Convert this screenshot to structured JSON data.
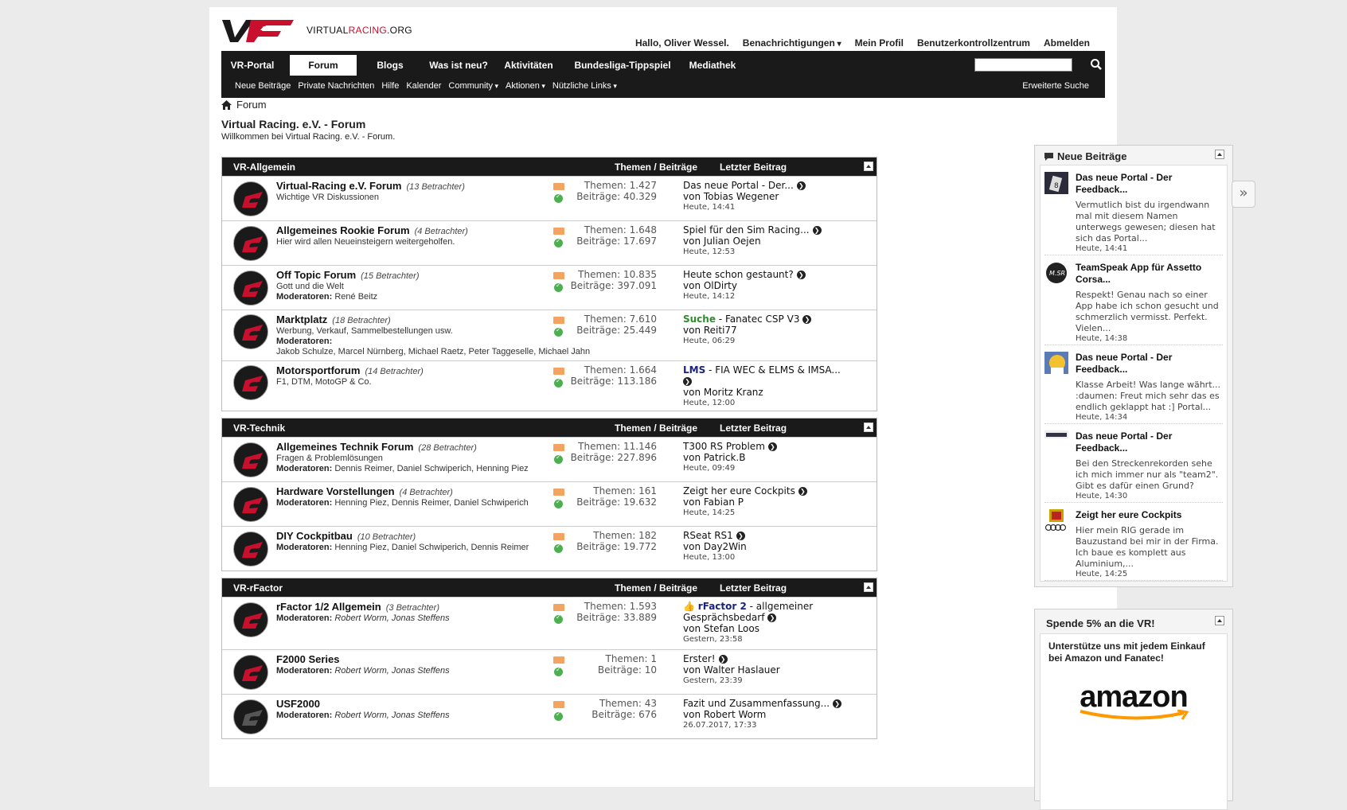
{
  "header": {
    "logo_text_pre": "VIRTUAL",
    "logo_text_red": "RACING",
    "logo_text_post": ".ORG",
    "user_links": [
      "Hallo, Oliver Wessel.",
      "Benachrichtigungen",
      "Mein Profil",
      "Benutzerkontrollzentrum",
      "Abmelden"
    ]
  },
  "nav": {
    "tabs": [
      "VR-Portal",
      "Forum",
      "Blogs",
      "Was ist neu?",
      "Aktivitäten",
      "Bundesliga-Tippspiel",
      "Mediathek"
    ],
    "active_tab": "Forum",
    "sub": [
      "Neue Beiträge",
      "Private Nachrichten",
      "Hilfe",
      "Kalender",
      "Community",
      "Aktionen",
      "Nützliche Links"
    ],
    "advanced_search": "Erweiterte Suche"
  },
  "breadcrumb": "Forum",
  "page": {
    "title": "Virtual Racing. e.V. - Forum",
    "subtitle": "Willkommen bei Virtual Racing. e.V. - Forum."
  },
  "labels": {
    "stats_header": "Themen / Beiträge",
    "last_header": "Letzter Beitrag"
  },
  "categories": [
    {
      "name": "VR-Allgemein",
      "forums": [
        {
          "title": "Virtual-Racing e.V. Forum",
          "viewers": "(13 Betrachter)",
          "desc": "Wichtige VR Diskussionen",
          "threads": "Themen: 1.427",
          "posts": "Beiträge: 40.329",
          "last_title": "Das neue Portal - Der...",
          "last_by": "von Tobias Wegener",
          "last_time": "Heute, 14:41"
        },
        {
          "title": "Allgemeines Rookie Forum",
          "viewers": "(4 Betrachter)",
          "desc": "Hier wird allen Neueinsteigern weitergeholfen.",
          "threads": "Themen: 1.648",
          "posts": "Beiträge: 17.697",
          "last_title": "Spiel für den Sim Racing...",
          "last_by": "von Julian Oejen",
          "last_time": "Heute, 12:53"
        },
        {
          "title": "Off Topic Forum",
          "viewers": "(15 Betrachter)",
          "desc": "Gott und die Welt",
          "mods_label": "Moderatoren:",
          "mods": "René Beitz",
          "threads": "Themen: 10.835",
          "posts": "Beiträge: 397.091",
          "last_title": "Heute schon gestaunt?",
          "last_by": "von OlDirty",
          "last_time": "Heute, 14:12"
        },
        {
          "title": "Marktplatz",
          "viewers": "(18 Betrachter)",
          "desc": "Werbung, Verkauf, Sammelbestellungen usw.",
          "mods_label": "Moderatoren:",
          "mods": "Jakob Schulze, Marcel Nürnberg, Michael Raetz, Peter Taggeselle, Michael Jahn",
          "threads": "Themen: 7.610",
          "posts": "Beiträge: 25.449",
          "last_prefix": "Suche",
          "last_title": " - Fanatec CSP V3",
          "last_by": "von Reiti77",
          "last_time": "Heute, 06:29"
        },
        {
          "title": "Motorsportforum",
          "viewers": "(14 Betrachter)",
          "desc": "F1, DTM, MotoGP & Co.",
          "threads": "Themen: 1.664",
          "posts": "Beiträge: 113.186",
          "last_prefix": "LMS",
          "last_title": " - FIA WEC & ELMS & IMSA...",
          "last_by": "von Moritz Kranz",
          "last_time": "Heute, 12:00"
        }
      ]
    },
    {
      "name": "VR-Technik",
      "forums": [
        {
          "title": "Allgemeines Technik Forum",
          "viewers": "(28 Betrachter)",
          "desc": "Fragen & Problemlösungen",
          "mods_label": "Moderatoren:",
          "mods": "Dennis Reimer, Daniel Schwiperich, Henning Piez",
          "threads": "Themen: 11.146",
          "posts": "Beiträge: 227.896",
          "last_title": "T300 RS Problem",
          "last_by": "von Patrick.B",
          "last_time": "Heute, 09:49"
        },
        {
          "title": "Hardware Vorstellungen",
          "viewers": "(4 Betrachter)",
          "mods_label": "Moderatoren:",
          "mods": "Henning Piez, Dennis Reimer, Daniel Schwiperich",
          "threads": "Themen: 161",
          "posts": "Beiträge: 19.632",
          "last_title": "Zeigt her eure Cockpits",
          "last_by": "von Fabian P",
          "last_time": "Heute, 14:25"
        },
        {
          "title": "DIY Cockpitbau",
          "viewers": "(10 Betrachter)",
          "mods_label": "Moderatoren:",
          "mods": "Henning Piez, Daniel Schwiperich, Dennis Reimer",
          "threads": "Themen: 182",
          "posts": "Beiträge: 19.772",
          "last_title": "RSeat RS1",
          "last_by": "von Day2Win",
          "last_time": "Heute, 13:00"
        }
      ]
    },
    {
      "name": "VR-rFactor",
      "forums": [
        {
          "title": "rFactor 1/2 Allgemein",
          "viewers": "(3 Betrachter)",
          "mods_label": "Moderatoren:",
          "mods": "Robert Worm, Jonas Steffens",
          "mods_italic": true,
          "threads": "Themen: 1.593",
          "posts": "Beiträge: 33.889",
          "last_prefix": "rFactor 2",
          "last_title": " - allgemeiner Gesprächsbedarf",
          "last_by": "von Stefan Loos",
          "last_time": "Gestern, 23:58",
          "thumb": true
        },
        {
          "title": "F2000 Series",
          "mods_label": "Moderatoren:",
          "mods": "Robert Worm, Jonas Steffens",
          "mods_italic": true,
          "threads": "Themen: 1",
          "posts": "Beiträge: 10",
          "last_title": "Erster!",
          "last_by": "von Walter Haslauer",
          "last_time": "Gestern, 23:39"
        },
        {
          "title": "USF2000",
          "mods_label": "Moderatoren:",
          "mods": "Robert Worm, Jonas Steffens",
          "mods_italic": true,
          "threads": "Themen: 43",
          "posts": "Beiträge: 676",
          "last_title": "Fazit und Zusammenfassung...",
          "last_by": "von Robert Worm",
          "last_time": "26.07.2017, 17:33",
          "grey": true
        }
      ]
    }
  ],
  "sidebar": {
    "new_posts_title": "Neue Beiträge",
    "posts": [
      {
        "title": "Das neue Portal - Der Feedback...",
        "body": "Vermutlich bist du irgendwann mal mit diesem Namen unterwegs gewesen; diesen hat sich das Portal...",
        "time": "Heute, 14:41",
        "avatar": "dark"
      },
      {
        "title": "TeamSpeak App für Assetto Corsa...",
        "body": "Respekt! Genau nach so einer App habe ich schon gesucht und schmerzlich vermisst. Perfekt. Vielen...",
        "time": "Heute, 14:38",
        "avatar": "round"
      },
      {
        "title": "Das neue Portal - Der Feedback...",
        "body": "Klasse Arbeit! Was lange währt... :daumen: Freut mich sehr das es endlich geklappt hat :] Portal...",
        "time": "Heute, 14:34",
        "avatar": "yellow"
      },
      {
        "title": "Das neue Portal - Der Feedback...",
        "body": "Bei den Streckenrekorden sehe ich mich immer nur als \"team2\". Gibt es dafür einen Grund?",
        "time": "Heute, 14:30",
        "avatar": "car"
      },
      {
        "title": "Zeigt her eure Cockpits",
        "body": "Hier mein RIG gerade im Bauzustand bei mir in der Firma. Ich baue es komplett aus Aluminium,...",
        "time": "Heute, 14:25",
        "avatar": "crest"
      }
    ],
    "donate_title": "Spende 5% an die VR!",
    "donate_text": "Unterstütze uns mit jedem Einkauf bei Amazon und Fanatec!",
    "amazon": "amazon"
  },
  "colors": {
    "accent_red": "#c8102e",
    "bar": "#1a1a1a"
  }
}
